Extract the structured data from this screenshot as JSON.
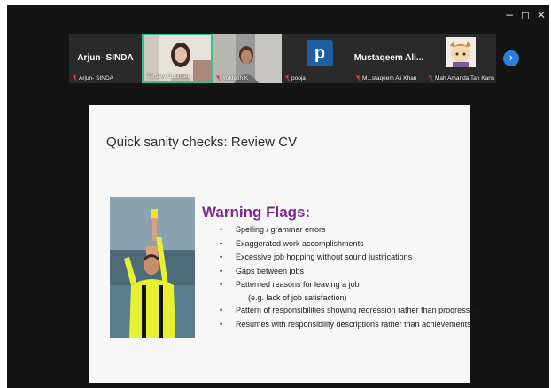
{
  "window_controls": {
    "minimize": "−",
    "maximize": "◻",
    "close": "✕"
  },
  "participants": [
    {
      "kind": "name",
      "display_name": "Arjun- SINDA",
      "label": "Arjun- SINDA",
      "muted": true
    },
    {
      "kind": "video",
      "label": "Tertiary Counsel...",
      "muted": false,
      "highlighted": true
    },
    {
      "kind": "video",
      "label": "Yuktesh K",
      "muted": true,
      "highlighted": false
    },
    {
      "kind": "avatar",
      "avatar_letter": "p",
      "label": "pooja",
      "muted": true,
      "avatar_color": "#1e5fa3"
    },
    {
      "kind": "name",
      "display_name": "Mustaqeem Ali...",
      "label": "M...staqeem Ali Khan",
      "muted": true
    },
    {
      "kind": "image",
      "label": "Mah Amanda Tan Kans",
      "muted": true
    }
  ],
  "next_button": {
    "icon": "chevron-right-icon",
    "glyph": "›"
  },
  "slide": {
    "title": "Quick sanity checks: Review CV",
    "heading": "Warning Flags:",
    "heading_color": "#7d2a8f",
    "bullets": [
      "Spelling / grammar errors",
      "Exaggerated work accomplishments",
      "Excessive job hopping without sound justifications",
      "Gaps between jobs",
      "Patterned reasons for leaving a job",
      "(e.g. lack of job satisfaction)",
      "Pattern of responsibilities showing regression rather than progression",
      "Resumes with responsibility descriptions rather than achievements"
    ],
    "bullet_char": "•"
  },
  "colors": {
    "background": "#141414",
    "highlight_border": "#36c28c",
    "mute_icon": "#e23a3a",
    "next_button": "#2d7ddb"
  }
}
